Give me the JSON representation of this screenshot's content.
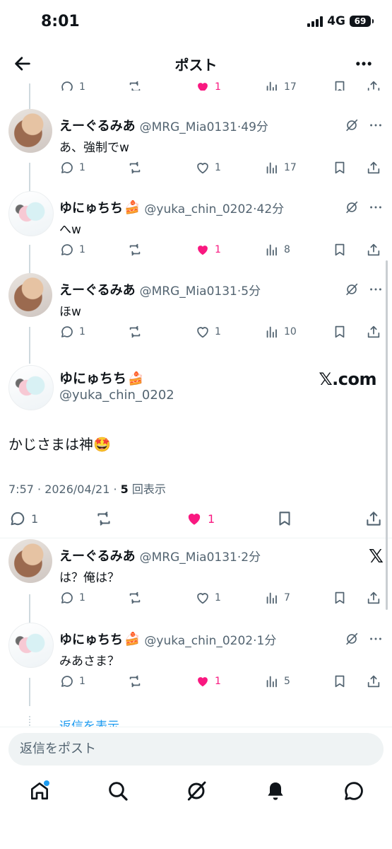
{
  "status": {
    "time": "8:01",
    "network": "4G",
    "battery": "69"
  },
  "header": {
    "title": "ポスト"
  },
  "thread_replies": [
    {
      "name": "えーぐるみあ",
      "handle": "@MRG_Mia0131·49分",
      "text": "あ、強制でw",
      "replies": "1",
      "likes": "1",
      "views": "17",
      "liked": false,
      "avatar": "mia"
    },
    {
      "name": "ゆにゅちち",
      "handle": "@yuka_chin_0202·42分",
      "text": "へw",
      "replies": "1",
      "likes": "1",
      "views": "8",
      "liked": true,
      "avatar": "yuka"
    },
    {
      "name": "えーぐるみあ",
      "handle": "@MRG_Mia0131·5分",
      "text": "ほw",
      "replies": "1",
      "likes": "1",
      "views": "10",
      "liked": false,
      "avatar": "mia"
    }
  ],
  "top_partial": {
    "replies": "1",
    "likes": "1",
    "views": "17"
  },
  "main_tweet": {
    "name": "ゆにゅちち",
    "handle": "@yuka_chin_0202",
    "watermark": "𝕏.com",
    "text": "かじさまは神🤩",
    "meta_prefix": "7:57 · 2026/04/21 · ",
    "meta_count": "5",
    "meta_suffix": " 回表示",
    "replies": "1",
    "likes": "1"
  },
  "below_replies": [
    {
      "name": "えーぐるみあ",
      "handle": "@MRG_Mia0131·2分",
      "text": "は？俺は？",
      "replies": "1",
      "likes": "1",
      "views": "7",
      "liked": false,
      "avatar": "mia"
    },
    {
      "name": "ゆにゅちち",
      "handle": "@yuka_chin_0202·1分",
      "text": "みあさま？",
      "replies": "1",
      "likes": "1",
      "views": "5",
      "liked": true,
      "avatar": "yuka"
    }
  ],
  "show_replies": "返信を表示",
  "reply_placeholder": "返信をポスト",
  "colors": {
    "like_pink": "#f91880",
    "link_blue": "#1d9bf0",
    "text_gray": "#536471"
  },
  "icons": [
    "back-arrow-icon",
    "more-icon",
    "grok-icon",
    "reply-icon",
    "retweet-icon",
    "like-icon",
    "views-icon",
    "bookmark-icon",
    "share-icon",
    "home-icon",
    "search-icon",
    "grok-nav-icon",
    "notifications-icon",
    "messages-icon",
    "x-logo-icon"
  ]
}
